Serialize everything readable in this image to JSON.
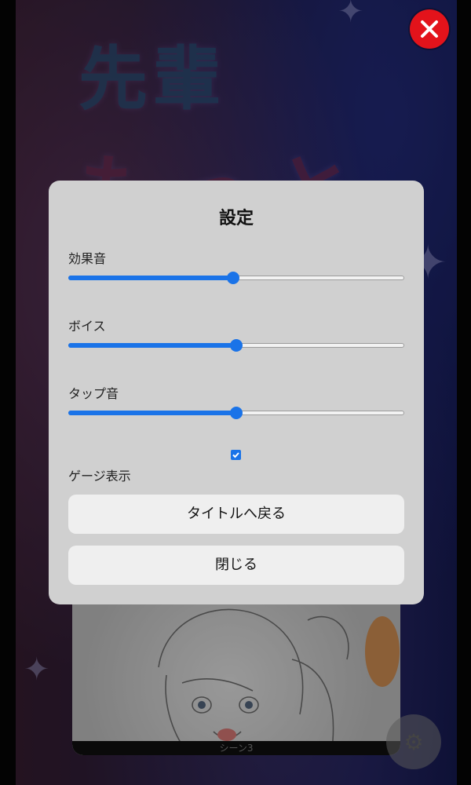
{
  "settings": {
    "title": "設定",
    "sliders": [
      {
        "label": "効果音",
        "value": 0.49
      },
      {
        "label": "ボイス",
        "value": 0.5
      },
      {
        "label": "タップ音",
        "value": 0.5
      }
    ],
    "gauge": {
      "label": "ゲージ表示",
      "checked": true
    },
    "buttons": {
      "back_to_title": "タイトルへ戻る",
      "close": "閉じる"
    }
  },
  "background": {
    "title_line1": "先輩",
    "title_line2": "もっと触って",
    "scene_label": "シーン3"
  },
  "icons": {
    "close": "close-x-icon",
    "settings": "gear-icon"
  },
  "colors": {
    "accent": "#1a73e8",
    "close_button": "#e3131b",
    "modal_bg": "#d0d0d0",
    "button_bg": "#efefef"
  }
}
